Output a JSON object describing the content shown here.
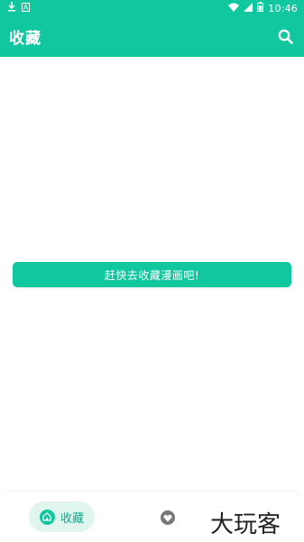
{
  "status_bar": {
    "time": "10:46",
    "left_icons": [
      "download-icon",
      "notification-icon"
    ],
    "right_icons": [
      "wifi-icon",
      "signal-icon",
      "battery-icon"
    ]
  },
  "app_bar": {
    "title": "收藏",
    "search_icon": "search-icon"
  },
  "main": {
    "empty_action_label": "赶快去收藏漫画吧!"
  },
  "bottom_nav": {
    "items": [
      {
        "label": "收藏",
        "icon": "home-icon",
        "active": true
      },
      {
        "label": "",
        "icon": "heart-icon",
        "active": false
      }
    ]
  },
  "watermark": "大玩客",
  "colors": {
    "primary": "#11c7a0",
    "active_pill_bg": "#dff5ee",
    "active_text": "#11a888",
    "inactive_icon": "#777777"
  }
}
